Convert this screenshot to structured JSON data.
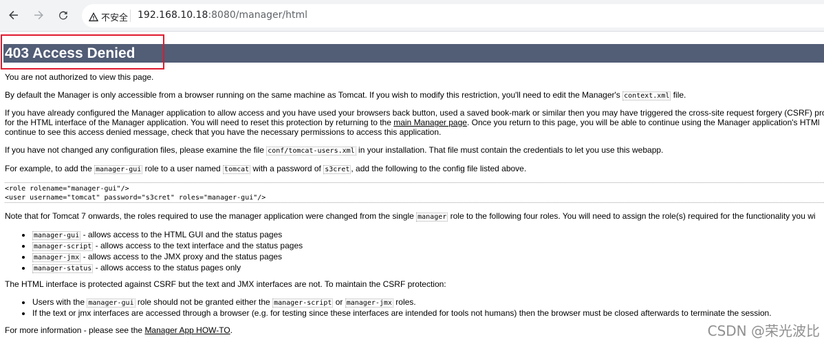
{
  "browser": {
    "security_label": "不安全",
    "url_host": "192.168.10.18",
    "url_rest": ":8080/manager/html"
  },
  "page": {
    "title": "403 Access Denied",
    "p1": "You are not authorized to view this page.",
    "p2_a": "By default the Manager is only accessible from a browser running on the same machine as Tomcat. If you wish to modify this restriction, you'll need to edit the Manager's ",
    "p2_code": "context.xml",
    "p2_b": " file.",
    "p3_line1": "If you have already configured the Manager application to allow access and you have used your browsers back button, used a saved book-mark or similar then you may have triggered the cross-site request forgery (CSRF) pro",
    "p3_line2_a": "for the HTML interface of the Manager application. You will need to reset this protection by returning to the ",
    "p3_link": "main Manager page",
    "p3_line2_b": ". Once you return to this page, you will be able to continue using the Manager application's HTMl",
    "p3_line3": "continue to see this access denied message, check that you have the necessary permissions to access this application.",
    "p4_a": "If you have not changed any configuration files, please examine the file ",
    "p4_code": "conf/tomcat-users.xml",
    "p4_b": " in your installation. That file must contain the credentials to let you use this webapp.",
    "p5_a": "For example, to add the ",
    "p5_code1": "manager-gui",
    "p5_b": " role to a user named ",
    "p5_code2": "tomcat",
    "p5_c": " with a password of ",
    "p5_code3": "s3cret",
    "p5_d": ", add the following to the config file listed above.",
    "code_line1": "<role rolename=\"manager-gui\"/>",
    "code_line2": "<user username=\"tomcat\" password=\"s3cret\" roles=\"manager-gui\"/>",
    "p6_a": "Note that for Tomcat 7 onwards, the roles required to use the manager application were changed from the single ",
    "p6_code": "manager",
    "p6_b": " role to the following four roles. You will need to assign the role(s) required for the functionality you wi",
    "roles": [
      {
        "code": "manager-gui",
        "text": " - allows access to the HTML GUI and the status pages"
      },
      {
        "code": "manager-script",
        "text": " - allows access to the text interface and the status pages"
      },
      {
        "code": "manager-jmx",
        "text": " - allows access to the JMX proxy and the status pages"
      },
      {
        "code": "manager-status",
        "text": " - allows access to the status pages only"
      }
    ],
    "p7": "The HTML interface is protected against CSRF but the text and JMX interfaces are not. To maintain the CSRF protection:",
    "b1_a": "Users with the ",
    "b1_code1": "manager-gui",
    "b1_b": " role should not be granted either the ",
    "b1_code2": "manager-script",
    "b1_c": " or ",
    "b1_code3": "manager-jmx",
    "b1_d": " roles.",
    "b2": "If the text or jmx interfaces are accessed through a browser (e.g. for testing since these interfaces are intended for tools not humans) then the browser must be closed afterwards to terminate the session.",
    "p8_a": "For more information - please see the ",
    "p8_link": "Manager App HOW-TO",
    "p8_b": "."
  },
  "watermark": "CSDN @荣光波比"
}
